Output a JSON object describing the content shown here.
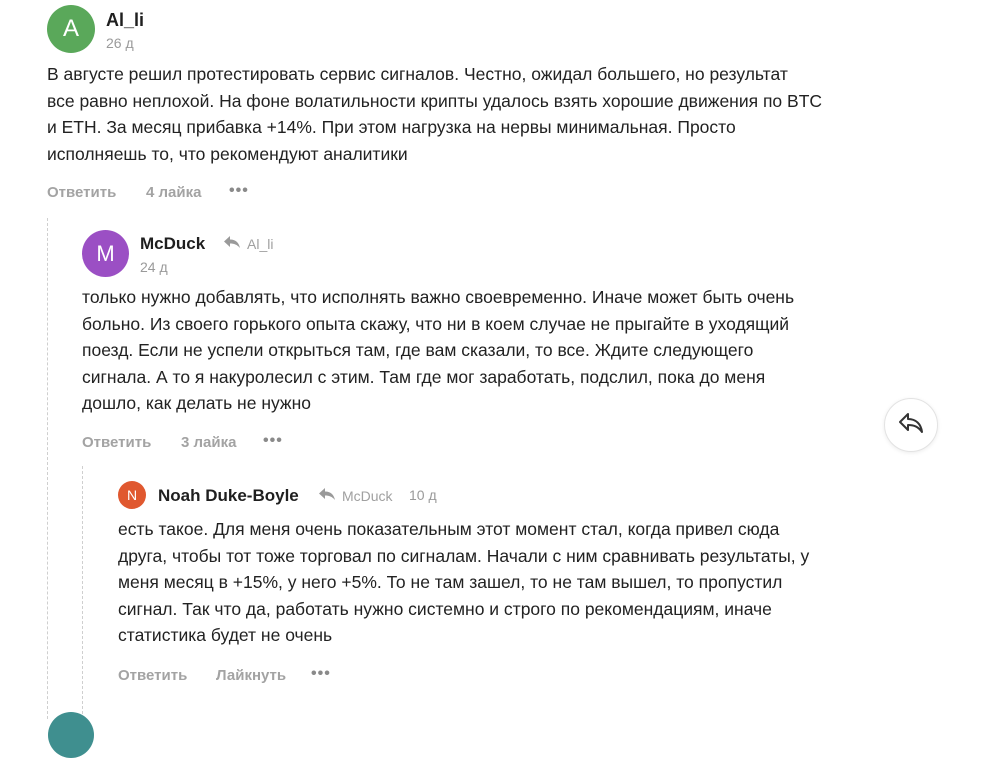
{
  "comments": [
    {
      "avatar_letter": "A",
      "avatar_color": "#5aa85a",
      "author": "Al_li",
      "time": "26 д",
      "text_lines": [
        "В августе решил протестировать сервис сигналов. Честно, ожидал большего, но результат",
        "все равно неплохой. На фоне волатильности крипты удалось взять хорошие движения по BTC",
        "и ETH. За месяц прибавка +14%. При этом нагрузка на нервы минимальная. Просто",
        "исполняешь то, что рекомендуют аналитики"
      ],
      "reply_label": "Ответить",
      "likes_label": "4 лайка"
    },
    {
      "avatar_letter": "M",
      "avatar_color": "#9b4fc4",
      "author": "McDuck",
      "reply_to": "Al_li",
      "time": "24 д",
      "text_lines": [
        "только нужно добавлять, что исполнять важно своевременно. Иначе может быть очень",
        "больно. Из своего горького опыта скажу, что ни в коем случае не прыгайте в уходящий",
        "поезд. Если не успели открыться там, где вам сказали, то все. Ждите следующего",
        "сигнала. А то я накуролесил с этим. Там где мог заработать, подслил, пока до меня",
        "дошло, как делать не нужно"
      ],
      "reply_label": "Ответить",
      "likes_label": "3 лайка"
    },
    {
      "avatar_letter": "N",
      "avatar_color": "#e0582f",
      "author": "Noah Duke-Boyle",
      "reply_to": "McDuck",
      "time": "10 д",
      "text_lines": [
        "есть такое. Для меня очень показательным этот момент стал, когда привел сюда",
        "друга, чтобы тот тоже торговал по сигналам. Начали с ним сравнивать результаты, у",
        "меня месяц в +15%, у него +5%. То не там зашел, то не там вышел, то пропустил",
        "сигнал. Так что да, работать нужно системно и строго по рекомендациям, иначе",
        "статистика будет не очень"
      ],
      "reply_label": "Ответить",
      "likes_label": "Лайкнуть"
    }
  ],
  "more_label": "•••",
  "next_avatar_color": "#3f8f8f"
}
